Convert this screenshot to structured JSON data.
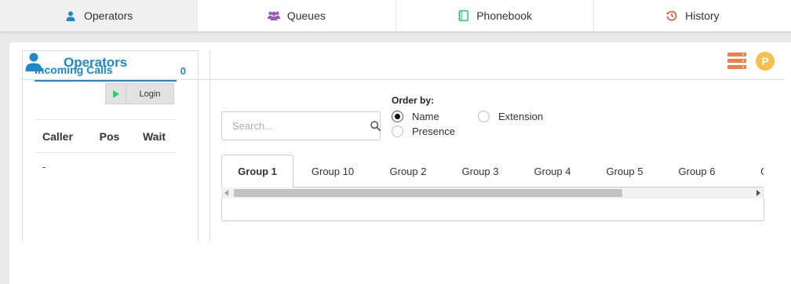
{
  "nav": {
    "tabs": [
      {
        "label": "Operators",
        "icon": "user-icon",
        "color": "#1e88c9",
        "active": true
      },
      {
        "label": "Queues",
        "icon": "users-icon",
        "color": "#9b59b6"
      },
      {
        "label": "Phonebook",
        "icon": "address-book-icon",
        "color": "#2ecc71"
      },
      {
        "label": "History",
        "icon": "history-icon",
        "color": "#e74c3c"
      }
    ]
  },
  "panel": {
    "title": "Operators",
    "badge": "P",
    "accent": "#1e88c9",
    "list_icon_color": "#f0804a",
    "badge_color": "#f5c04f"
  },
  "incoming": {
    "title": "Incoming Calls",
    "count": "0",
    "login_label": "Login",
    "columns": [
      "Caller",
      "Pos",
      "Wait"
    ],
    "rows": [
      [
        "-"
      ]
    ]
  },
  "search": {
    "placeholder": "Search..."
  },
  "order": {
    "label": "Order by:",
    "options": [
      {
        "label": "Name",
        "selected": true
      },
      {
        "label": "Extension",
        "selected": false
      },
      {
        "label": "Presence",
        "selected": false
      }
    ]
  },
  "groups": {
    "tabs": [
      "Group 1",
      "Group 10",
      "Group 2",
      "Group 3",
      "Group 4",
      "Group 5",
      "Group 6",
      "Gro"
    ],
    "active": "Group 1"
  }
}
